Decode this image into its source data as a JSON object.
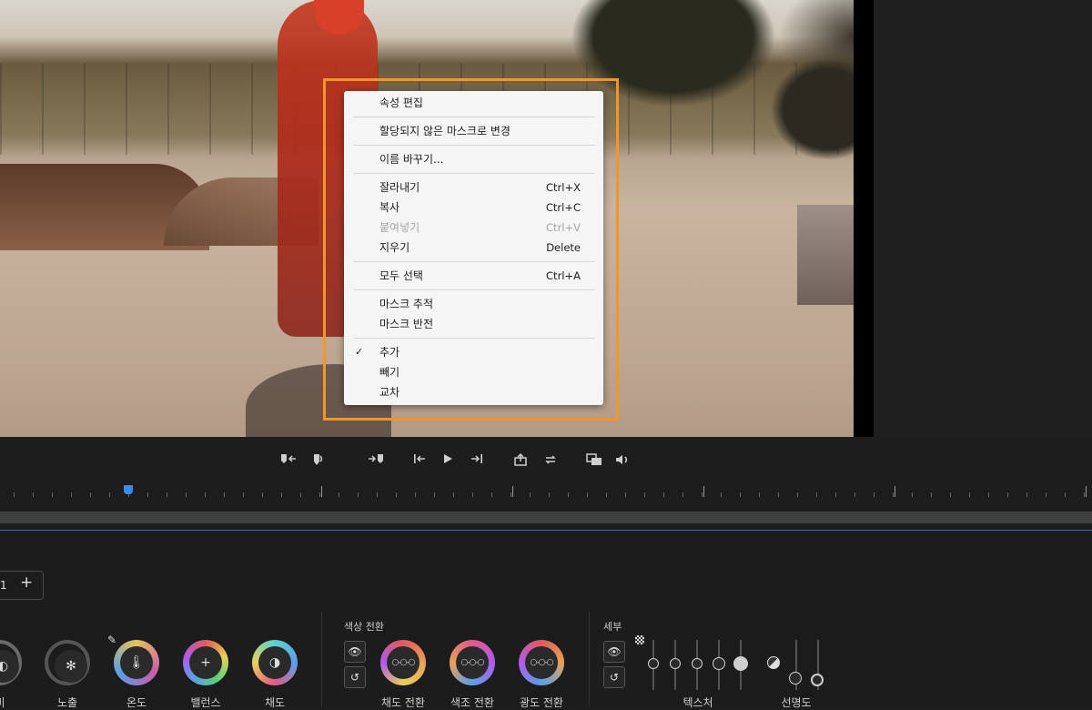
{
  "context_menu": {
    "items": [
      {
        "label": "속성 편집",
        "shortcut": "",
        "enabled": true,
        "checked": false
      },
      {
        "label": "할당되지 않은 마스크로 변경",
        "shortcut": "",
        "enabled": true,
        "checked": false
      },
      {
        "label": "이름 바꾸기...",
        "shortcut": "",
        "enabled": true,
        "checked": false
      },
      {
        "label": "잘라내기",
        "shortcut": "Ctrl+X",
        "enabled": true,
        "checked": false
      },
      {
        "label": "복사",
        "shortcut": "Ctrl+C",
        "enabled": true,
        "checked": false
      },
      {
        "label": "붙여넣기",
        "shortcut": "Ctrl+V",
        "enabled": false,
        "checked": false
      },
      {
        "label": "지우기",
        "shortcut": "Delete",
        "enabled": true,
        "checked": false
      },
      {
        "label": "모두 선택",
        "shortcut": "Ctrl+A",
        "enabled": true,
        "checked": false
      },
      {
        "label": "마스크 추적",
        "shortcut": "",
        "enabled": true,
        "checked": false
      },
      {
        "label": "마스크 반전",
        "shortcut": "",
        "enabled": true,
        "checked": false
      },
      {
        "label": "추가",
        "shortcut": "",
        "enabled": true,
        "checked": true
      },
      {
        "label": "빼기",
        "shortcut": "",
        "enabled": true,
        "checked": false
      },
      {
        "label": "교차",
        "shortcut": "",
        "enabled": true,
        "checked": false
      }
    ],
    "check_glyph": "✓"
  },
  "transport": {
    "buttons": [
      "mark-in-icon",
      "mark-clip-icon",
      "go-to-in-icon",
      "step-back-icon",
      "play-icon",
      "step-forward-icon",
      "export-frame-icon",
      "loop-icon",
      "safe-margins-icon",
      "volume-icon"
    ]
  },
  "tabs": {
    "current": "1",
    "add_label": "+"
  },
  "basic": {
    "knobs": [
      {
        "label": "비",
        "icon": "half-circle-icon"
      },
      {
        "label": "노출",
        "icon": "aperture-icon"
      },
      {
        "label": "온도",
        "icon": "thermometer-icon"
      },
      {
        "label": "밸런스",
        "icon": "plus-icon"
      },
      {
        "label": "채도",
        "icon": "saturation-icon"
      }
    ]
  },
  "color_shift": {
    "title": "색상 전환",
    "knobs": [
      {
        "label": "채도 전환"
      },
      {
        "label": "색조 전환"
      },
      {
        "label": "광도 전환"
      }
    ]
  },
  "detail": {
    "title": "세부",
    "groups": [
      {
        "label": "텍스처"
      },
      {
        "label": "선명도"
      }
    ]
  },
  "colors": {
    "highlight": "#f3962a",
    "menu_bg": "#f5f5f5",
    "playhead": "#3c8cf0",
    "panel_bg": "#1c1c1c"
  }
}
